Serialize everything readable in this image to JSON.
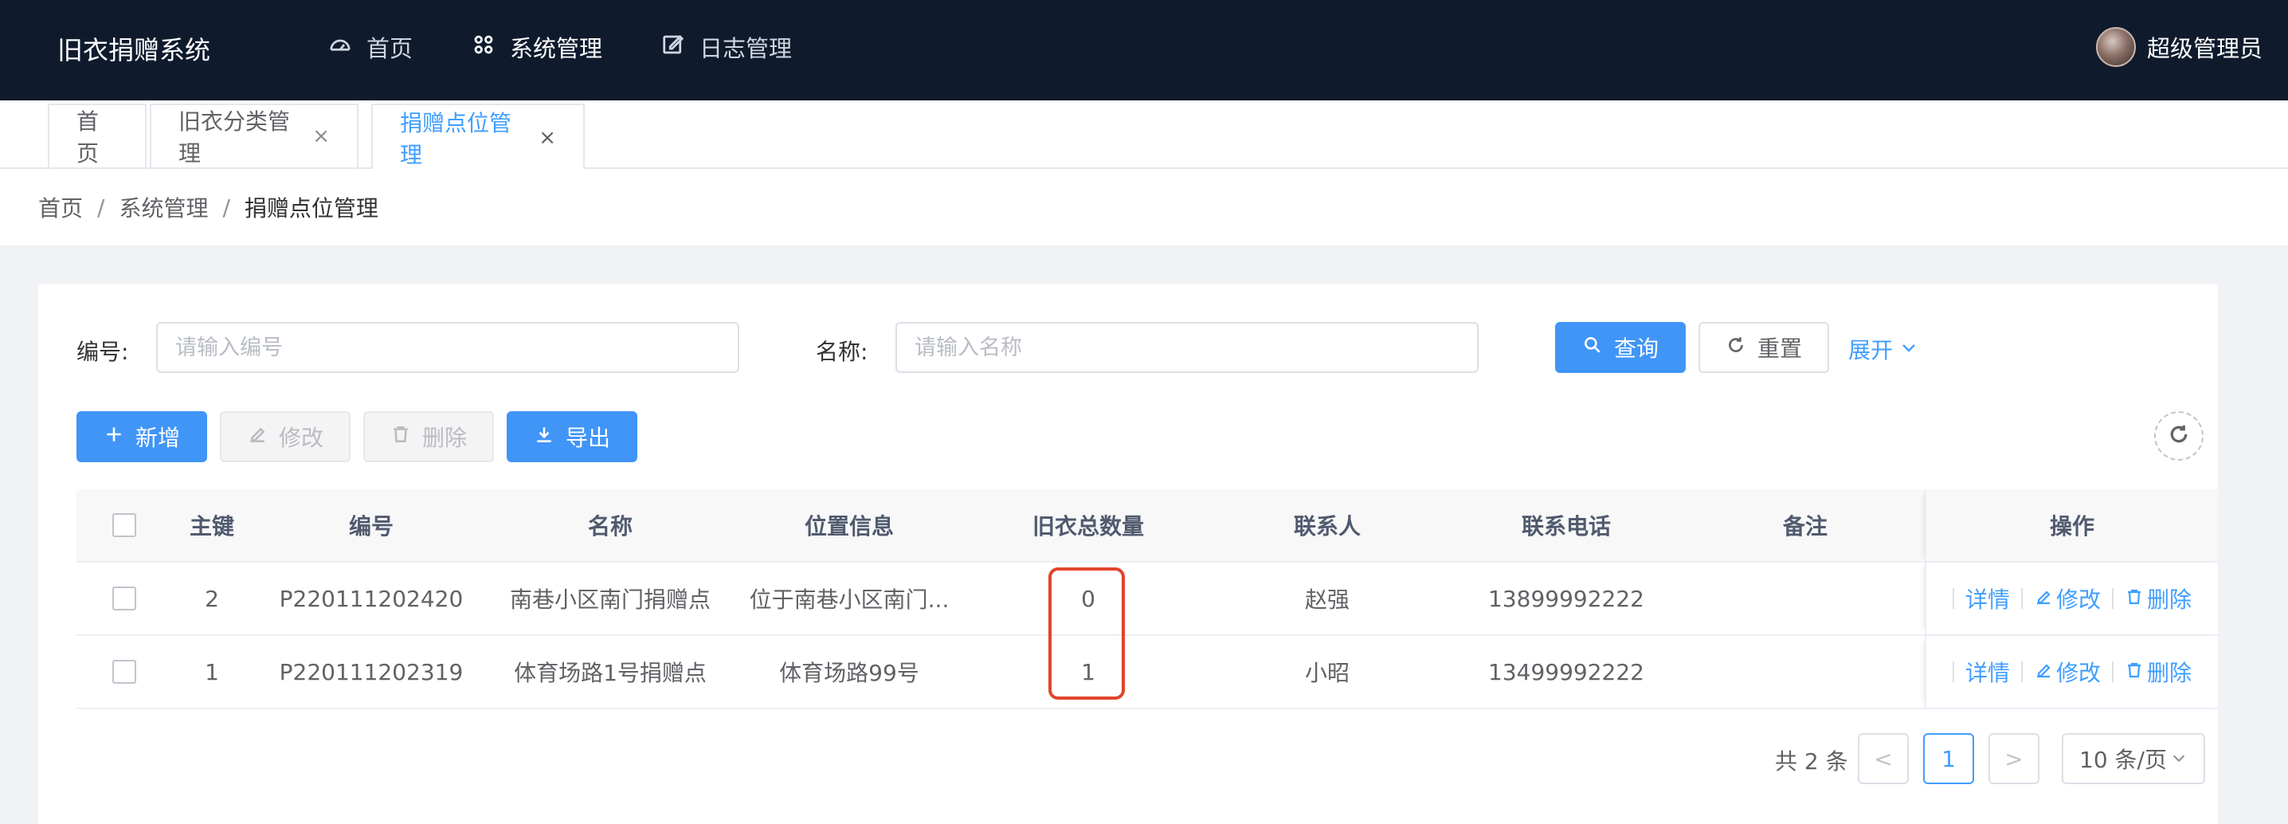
{
  "app": {
    "title": "旧衣捐赠系统"
  },
  "topnav": [
    {
      "label": "首页",
      "icon": "dashboard-icon"
    },
    {
      "label": "系统管理",
      "icon": "apps-icon"
    },
    {
      "label": "日志管理",
      "icon": "edit-icon"
    }
  ],
  "user": {
    "name": "超级管理员"
  },
  "tabs": [
    {
      "label": "首页"
    },
    {
      "label": "旧衣分类管理",
      "close": "×"
    },
    {
      "label": "捐赠点位管理",
      "close": "×"
    }
  ],
  "breadcrumb": {
    "items": [
      "首页",
      "系统管理",
      "捐赠点位管理"
    ],
    "sep": "/"
  },
  "search": {
    "code_label": "编号:",
    "code_placeholder": "请输入编号",
    "name_label": "名称:",
    "name_placeholder": "请输入名称",
    "query": "查询",
    "reset": "重置",
    "expand": "展开"
  },
  "toolbar": {
    "add": "新增",
    "edit": "修改",
    "delete": "删除",
    "export": "导出"
  },
  "table": {
    "headers": [
      "主键",
      "编号",
      "名称",
      "位置信息",
      "旧衣总数量",
      "联系人",
      "联系电话",
      "备注",
      "操作"
    ],
    "rows": [
      {
        "id": "2",
        "code": "P220111202420",
        "name": "南巷小区南门捐赠点",
        "location": "位于南巷小区南门...",
        "total": "0",
        "contact": "赵强",
        "phone": "13899992222",
        "note": ""
      },
      {
        "id": "1",
        "code": "P220111202319",
        "name": "体育场路1号捐赠点",
        "location": "体育场路99号",
        "total": "1",
        "contact": "小昭",
        "phone": "13499992222",
        "note": ""
      }
    ],
    "ops": {
      "detail": "详情",
      "edit": "修改",
      "delete": "删除"
    }
  },
  "pagination": {
    "total": "共 2 条",
    "prev": "<",
    "page": "1",
    "next": ">",
    "size": "10 条/页"
  },
  "colors": {
    "header_bg": "#0f1b2d",
    "primary": "#409eff",
    "highlight": "#e0452c"
  }
}
